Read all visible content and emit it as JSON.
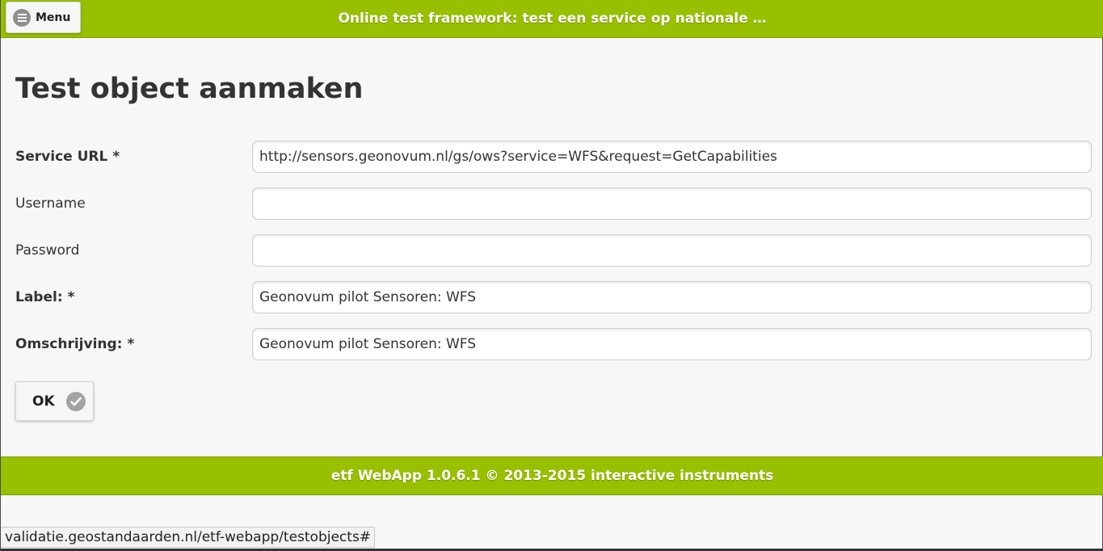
{
  "header": {
    "menu_label": "Menu",
    "title": "Online test framework: test een service op nationale …"
  },
  "main": {
    "page_title": "Test object aanmaken",
    "fields": [
      {
        "label": "Service URL *",
        "value": "http://sensors.geonovum.nl/gs/ows?service=WFS&request=GetCapabilities"
      },
      {
        "label": "Username",
        "value": ""
      },
      {
        "label": "Password",
        "value": ""
      },
      {
        "label": "Label: *",
        "value": "Geonovum pilot Sensoren: WFS"
      },
      {
        "label": "Omschrijving: *",
        "value": "Geonovum pilot Sensoren: WFS"
      }
    ],
    "ok_label": "OK"
  },
  "footer": {
    "text": "etf WebApp 1.0.6.1 © 2013-2015 interactive instruments"
  },
  "status_bar": {
    "url": "validatie.geostandaarden.nl/etf-webapp/testobjects#"
  },
  "colors": {
    "header_bg": "#98bf00",
    "page_bg": "#f7f7f7"
  },
  "icons": {
    "menu": "hamburger-circle-icon",
    "ok": "check-circle-icon"
  }
}
